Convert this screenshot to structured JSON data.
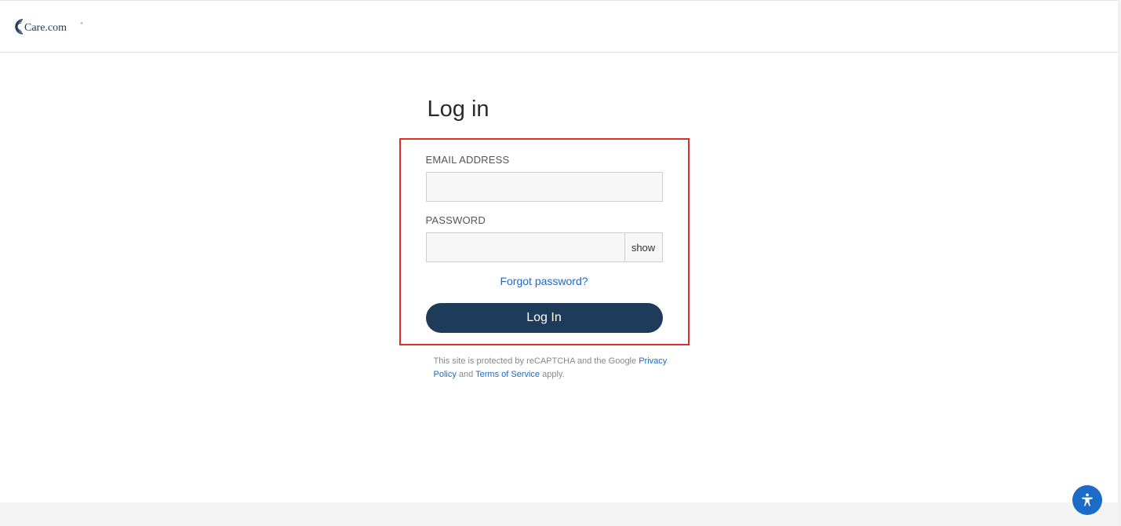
{
  "brand": {
    "name": "Care.com"
  },
  "login": {
    "title": "Log in",
    "email_label": "EMAIL ADDRESS",
    "password_label": "PASSWORD",
    "show_label": "show",
    "forgot_label": "Forgot password?",
    "submit_label": "Log In"
  },
  "recaptcha": {
    "prefix": "This site is protected by reCAPTCHA and the Google ",
    "privacy_label": "Privacy Policy",
    "middle": " and ",
    "terms_label": "Terms of Service",
    "suffix": " apply."
  }
}
